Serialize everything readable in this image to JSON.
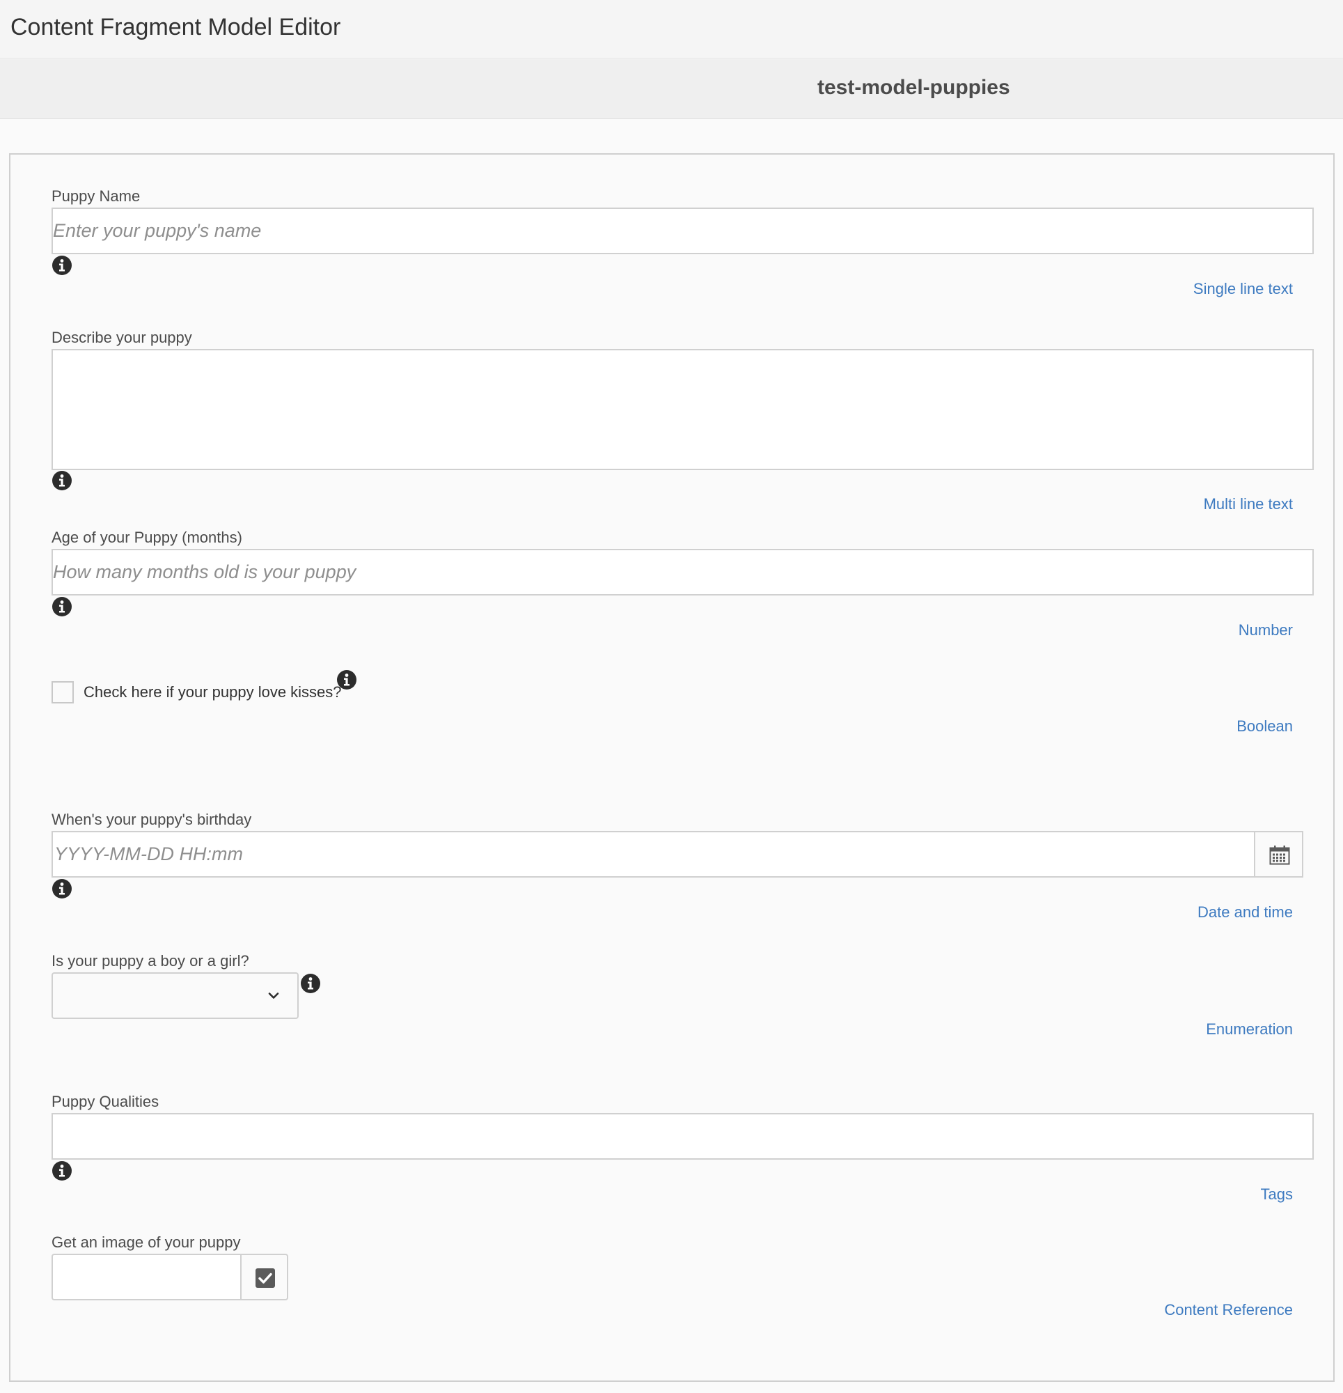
{
  "app": {
    "title": "Content Fragment Model Editor",
    "model_name": "test-model-puppies"
  },
  "colors": {
    "accent": "#3d7ac0",
    "label_text": "#4b4b4b",
    "border": "#d0d0d0"
  },
  "fields": {
    "puppy_name": {
      "label": "Puppy Name",
      "placeholder": "Enter your puppy's name",
      "value": "",
      "type": "Single line text",
      "icon": "info-icon"
    },
    "description": {
      "label": "Describe your puppy",
      "value": "",
      "type": "Multi line text",
      "icon": "info-icon"
    },
    "age": {
      "label": "Age of your Puppy (months)",
      "placeholder": "How many months old is your puppy",
      "value": "",
      "type": "Number",
      "icon": "info-icon"
    },
    "loves_kisses": {
      "label": "Check here if your puppy love kisses?",
      "checked": false,
      "type": "Boolean",
      "icon": "info-icon"
    },
    "birthday": {
      "label": "When's your puppy's birthday",
      "placeholder": "YYYY-MM-DD HH:mm",
      "value": "",
      "type": "Date and time",
      "icon": "info-icon",
      "button_icon": "calendar-icon"
    },
    "gender": {
      "label": "Is your puppy a boy or a girl?",
      "selected": "",
      "type": "Enumeration",
      "icon": "info-icon",
      "dropdown_icon": "chevron-down-icon"
    },
    "qualities": {
      "label": "Puppy Qualities",
      "value": "",
      "type": "Tags",
      "icon": "info-icon"
    },
    "image": {
      "label": "Get an image of your puppy",
      "value": "",
      "type": "Content Reference",
      "button_icon": "checkbox-checked-icon"
    }
  }
}
